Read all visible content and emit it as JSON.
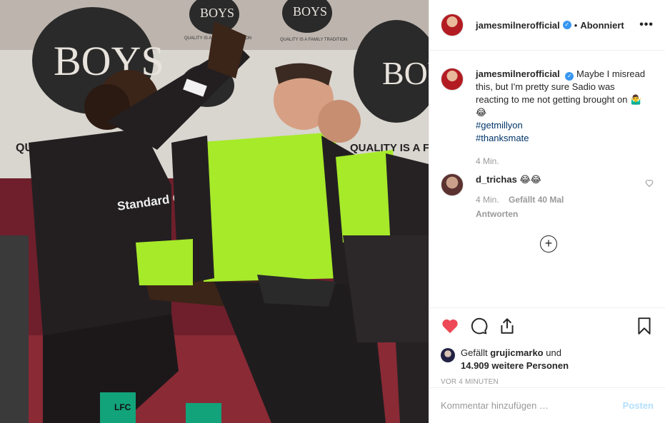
{
  "post": {
    "author": "jamesmilnerofficial",
    "follow_state": "Abonniert",
    "dot": "•",
    "more": "•••",
    "caption": "Maybe I misread this, but I'm pretty sure Sadio was reacting to me not getting brought on 🤷‍♂️😂",
    "hashtags": [
      "#getmillyon",
      "#thanksmate"
    ],
    "caption_time": "4 Min."
  },
  "photo_text": {
    "sign_boys": "BOYS",
    "tradition_1": "QUALITY IS A FAMILY TRADITION",
    "quality_left": "QUALITY",
    "quality_right": "QUALITY IS A FAMI",
    "sponsor": "Standard Chartered",
    "socks": "LFC"
  },
  "reply": {
    "user": "d_trichas",
    "text": "😂😂",
    "time": "4 Min.",
    "likes": "Gefällt 40 Mal",
    "reply_label": "Antworten"
  },
  "likes": {
    "prefix": "Gefällt",
    "user": "grujicmarko",
    "connector": "und",
    "count_text": "14.909 weitere Personen"
  },
  "timestamp": "VOR 4 MINUTEN",
  "add_comment": {
    "placeholder": "Kommentar hinzufügen …",
    "post_label": "Posten"
  },
  "colors": {
    "like_red": "#ed4956",
    "link_blue": "#003569",
    "bib_green": "#a6ea2a",
    "kit_black": "#231f21"
  },
  "icons": [
    "heart-filled-icon",
    "comment-icon",
    "share-icon",
    "bookmark-icon",
    "verified-icon",
    "plus-circle-icon",
    "heart-outline-icon"
  ]
}
